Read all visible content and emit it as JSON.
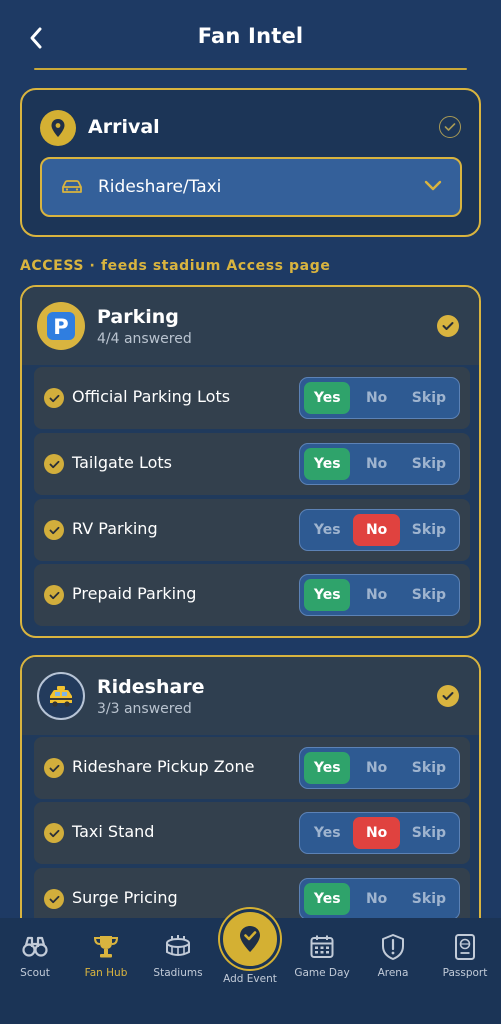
{
  "header": {
    "title": "Fan Intel"
  },
  "arrival": {
    "title": "Arrival",
    "selected": "Rideshare/Taxi"
  },
  "section_label": "ACCESS · feeds stadium Access page",
  "groups": [
    {
      "title": "Parking",
      "answered": "4/4 answered",
      "icon": "parking-icon",
      "questions": [
        {
          "label": "Official Parking Lots",
          "answer": "Yes"
        },
        {
          "label": "Tailgate Lots",
          "answer": "Yes"
        },
        {
          "label": "RV Parking",
          "answer": "No"
        },
        {
          "label": "Prepaid Parking",
          "answer": "Yes"
        }
      ]
    },
    {
      "title": "Rideshare",
      "answered": "3/3 answered",
      "icon": "taxi-icon",
      "questions": [
        {
          "label": "Rideshare Pickup Zone",
          "answer": "Yes"
        },
        {
          "label": "Taxi Stand",
          "answer": "No"
        },
        {
          "label": "Surge Pricing",
          "answer": "Yes"
        }
      ]
    }
  ],
  "options": {
    "yes": "Yes",
    "no": "No",
    "skip": "Skip"
  },
  "tabs": {
    "scout": "Scout",
    "fan_hub": "Fan Hub",
    "stadiums": "Stadiums",
    "add_event": "Add Event",
    "game_day": "Game Day",
    "arena": "Arena",
    "passport": "Passport"
  },
  "colors": {
    "background": "#1e3a64",
    "accent_gold": "#d9b43f",
    "yes_green": "#2fa36b",
    "no_red": "#e0423f"
  }
}
